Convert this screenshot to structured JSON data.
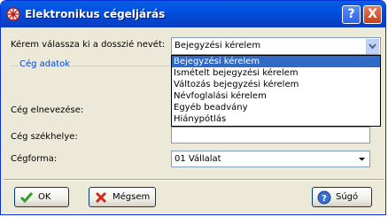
{
  "window": {
    "title": "Elektronikus cégeljárás",
    "help_button": "?",
    "close_button": "X"
  },
  "dossier": {
    "label": "Kérem válassza ki a dosszié nevét:",
    "selected": "Bejegyzési kérelem",
    "options": [
      "Bejegyzési kérelem",
      "Ismételt bejegyzési kérelem",
      "Változás bejegyzési kérelem",
      "Névfoglalási kérelem",
      "Egyéb beadvány",
      "Hiánypótlás"
    ]
  },
  "company": {
    "group_title": "Cég adatok",
    "name_label": "Cég elnevezése:",
    "name_value": "",
    "seat_label": "Cég székhelye:",
    "seat_value": "",
    "form_label": "Cégforma:",
    "form_value": "01 Vállalat"
  },
  "buttons": {
    "ok": "OK",
    "cancel": "Mégsem",
    "help": "Súgó"
  },
  "colors": {
    "titlebar": "#0054e3",
    "selection": "#316ac5",
    "group_title": "#0046d5",
    "dialog_bg": "#ece9d8"
  }
}
